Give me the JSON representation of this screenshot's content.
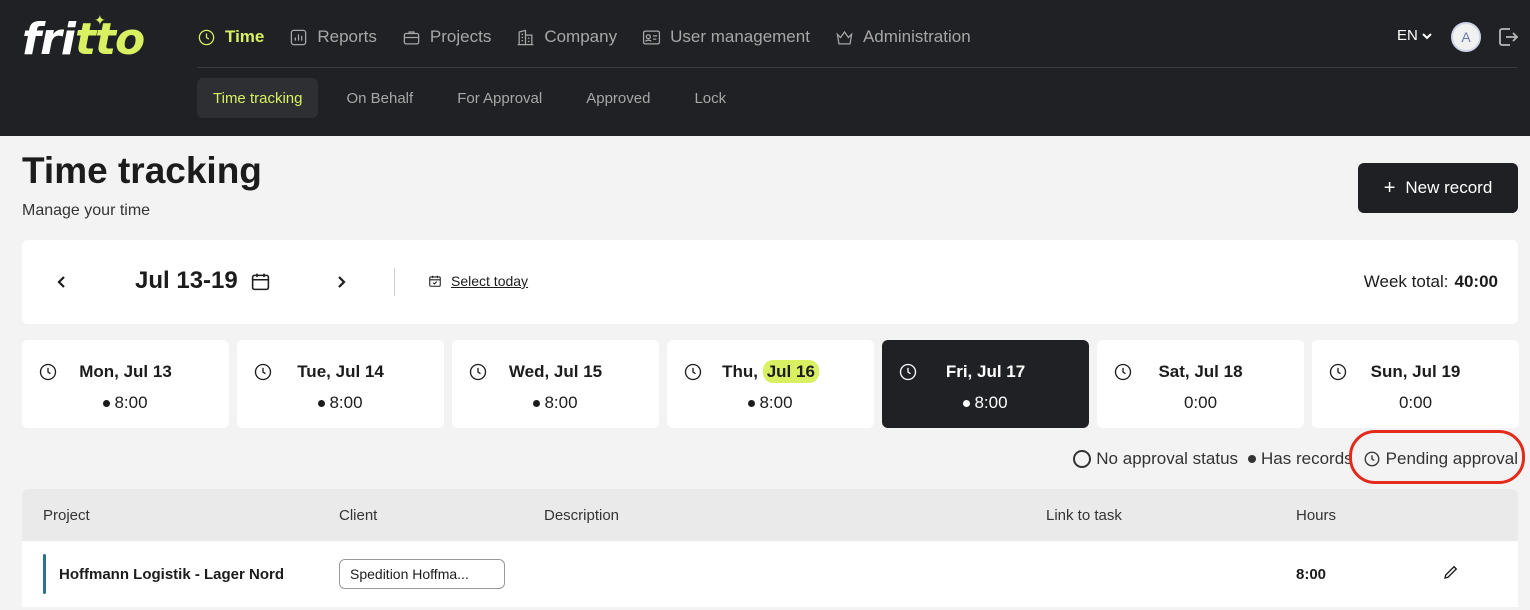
{
  "brand": {
    "logo_text_main": "fri",
    "logo_text_accent": "tto",
    "accent_color": "#d8f062"
  },
  "nav": {
    "items": [
      {
        "label": "Time",
        "icon": "clock-icon",
        "active": true
      },
      {
        "label": "Reports",
        "icon": "bar-chart-icon"
      },
      {
        "label": "Projects",
        "icon": "briefcase-icon"
      },
      {
        "label": "Company",
        "icon": "building-icon"
      },
      {
        "label": "User management",
        "icon": "id-card-icon"
      },
      {
        "label": "Administration",
        "icon": "crown-icon"
      }
    ],
    "language": "EN",
    "avatar_initial": "A"
  },
  "subnav": {
    "items": [
      {
        "label": "Time tracking",
        "active": true
      },
      {
        "label": "On Behalf"
      },
      {
        "label": "For Approval"
      },
      {
        "label": "Approved"
      },
      {
        "label": "Lock"
      }
    ]
  },
  "page": {
    "title": "Time tracking",
    "subtitle": "Manage your time",
    "new_record_label": "New record"
  },
  "week": {
    "range": "Jul 13-19",
    "select_today": "Select today",
    "total_label": "Week total:",
    "total_value": "40:00"
  },
  "days": [
    {
      "prefix": "Mon, ",
      "date": "Jul 13",
      "hours": "8:00",
      "has_records": true
    },
    {
      "prefix": "Tue, ",
      "date": "Jul 14",
      "hours": "8:00",
      "has_records": true
    },
    {
      "prefix": "Wed, ",
      "date": "Jul 15",
      "hours": "8:00",
      "has_records": true
    },
    {
      "prefix": "Thu, ",
      "date": "Jul 16",
      "hours": "8:00",
      "has_records": true,
      "today": true
    },
    {
      "prefix": "Fri, ",
      "date": "Jul 17",
      "hours": "8:00",
      "has_records": true,
      "selected": true
    },
    {
      "prefix": "Sat, ",
      "date": "Jul 18",
      "hours": "0:00",
      "has_records": false
    },
    {
      "prefix": "Sun, ",
      "date": "Jul 19",
      "hours": "0:00",
      "has_records": false
    }
  ],
  "legend": {
    "no_status": "No approval status",
    "has_records": "Has records",
    "pending": "Pending approval"
  },
  "table": {
    "headers": {
      "project": "Project",
      "client": "Client",
      "description": "Description",
      "link": "Link to task",
      "hours": "Hours"
    },
    "rows": [
      {
        "project": "Hoffmann Logistik - Lager Nord",
        "client": "Spedition Hoffma...",
        "description": "",
        "link": "",
        "hours": "8:00",
        "color": "#2d6f8c"
      }
    ]
  }
}
